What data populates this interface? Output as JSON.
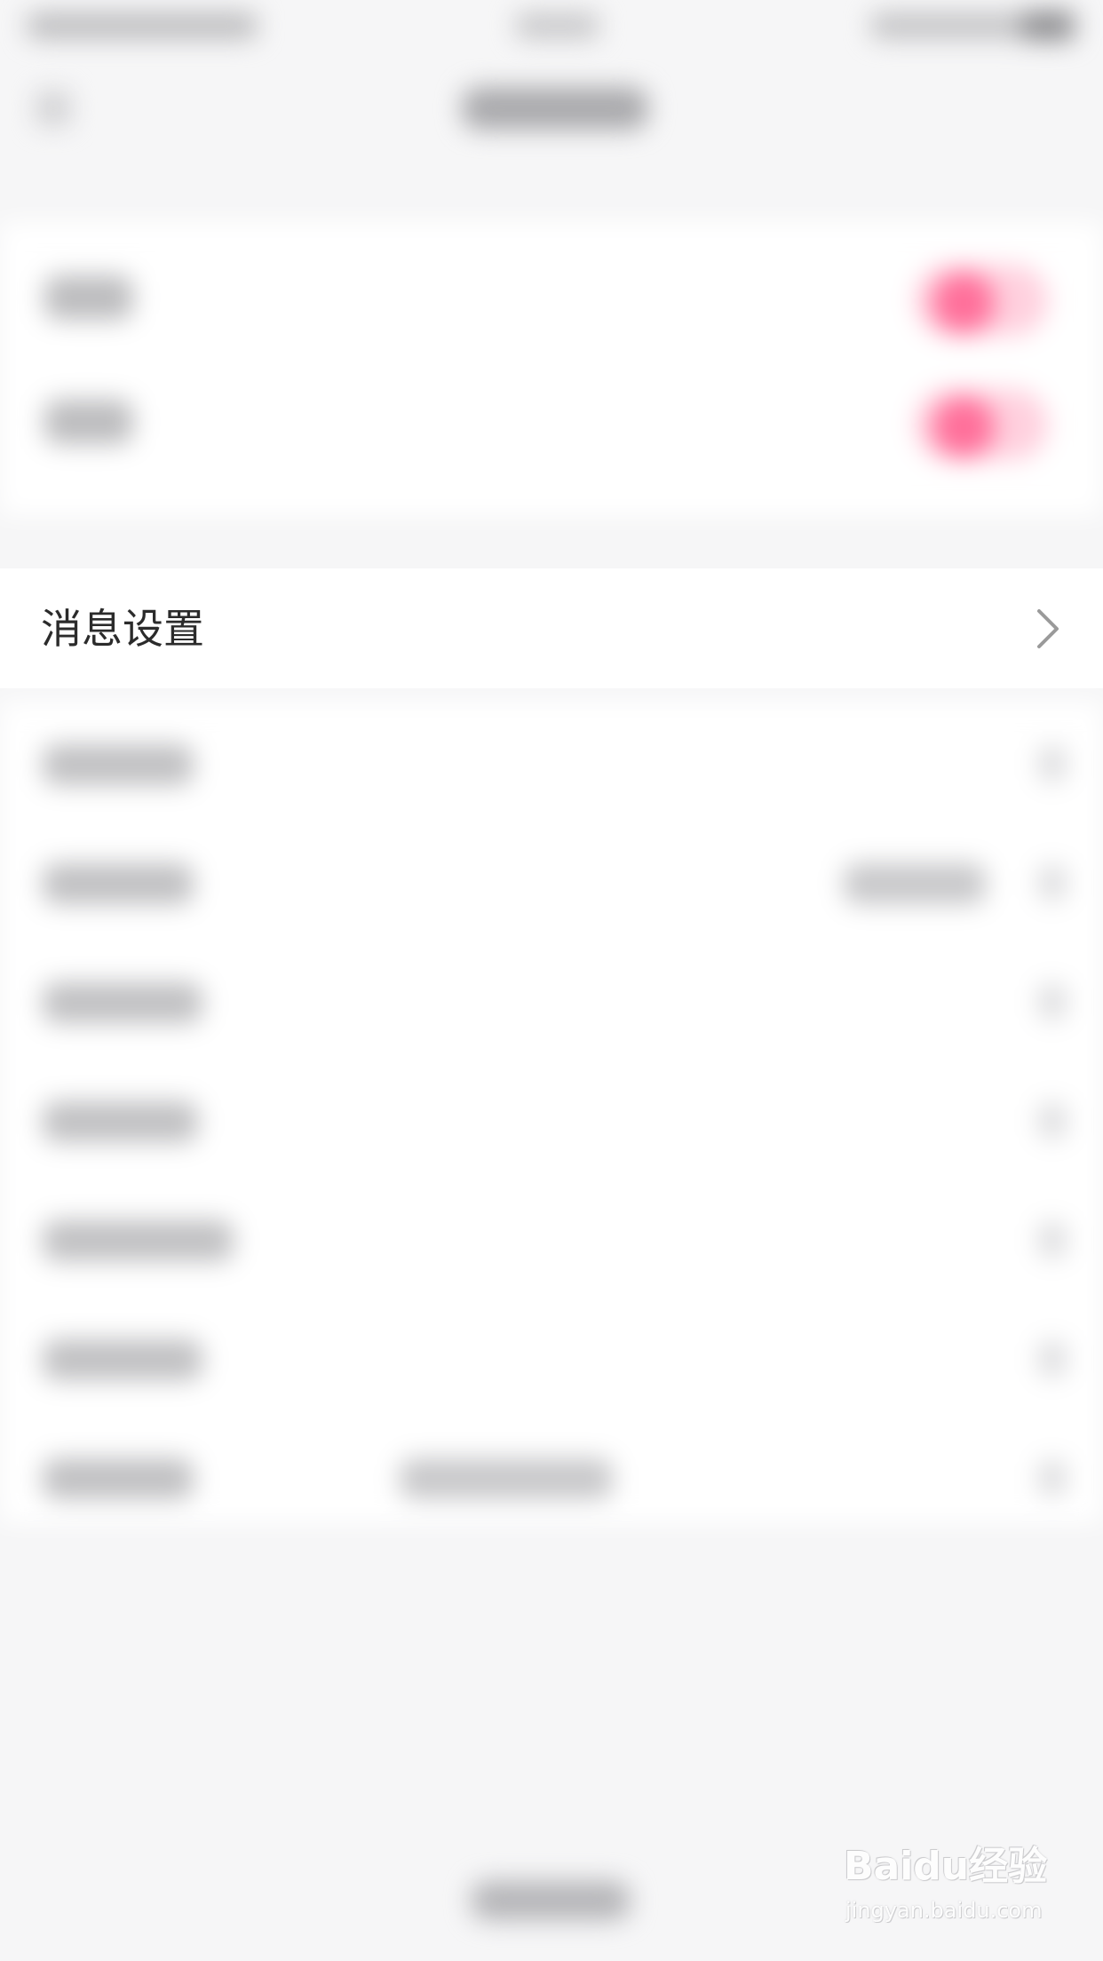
{
  "message_settings": {
    "label": "消息设置",
    "chevron_icon": "chevron-right-icon"
  },
  "toggles": [
    {
      "state": "on",
      "accent": "#ff6f9a"
    },
    {
      "state": "on",
      "accent": "#ff6f9a"
    }
  ],
  "watermark": {
    "logo": "Baidu经验",
    "url": "jingyan.baidu.com"
  },
  "colors": {
    "background": "#f6f6f7",
    "card": "#ffffff",
    "text": "#2b2b2b",
    "toggle_accent": "#ff6f9a"
  }
}
